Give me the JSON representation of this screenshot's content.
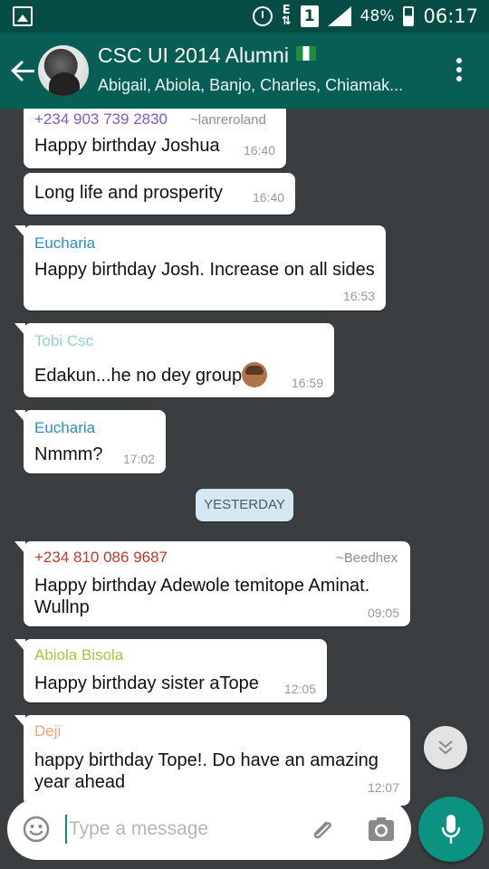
{
  "status_bar": {
    "battery": "48%",
    "time": "06:17",
    "data_indicator": "E",
    "sim_slot": "1"
  },
  "header": {
    "group_name": "CSC UI 2014 Alumni",
    "members": "Abigail, Abiola, Banjo, Charles, Chiamak..."
  },
  "messages": [
    {
      "sender": "+234 903 739 2830",
      "tag": "~lanreroland",
      "text": "Happy birthday Joshua",
      "time": "16:40",
      "sender_color": "#7c5bc4"
    },
    {
      "text": "Long life and prosperity",
      "time": "16:40"
    },
    {
      "sender": "Eucharia",
      "text": "Happy birthday Josh. Increase on all sides",
      "time": "16:53",
      "sender_color": "#2f8ad2"
    },
    {
      "sender": "Tobi Csc",
      "text": "Edakun...he no dey group",
      "time": "16:59",
      "sender_color": "#8fd6c9",
      "emoji": "man-facepalming-emoji"
    },
    {
      "sender": "Eucharia",
      "text": "Nmmm?",
      "time": "17:02",
      "sender_color": "#2f8ad2"
    },
    {
      "sender": "+234 810 086 9687",
      "tag": "~Beedhex",
      "text_line1": "Happy birthday Adewole temitope Aminat.",
      "text_line2": "Wullnp",
      "time": "09:05",
      "sender_color": "#c0392b"
    },
    {
      "sender": "Abiola Bisola",
      "text": "Happy birthday sister aTope",
      "time": "12:05",
      "sender_color": "#a9c23f"
    },
    {
      "sender": "Deji",
      "text_line1": "happy birthday Tope!. Do have an amazing",
      "text_line2": "year ahead",
      "time": "12:07",
      "sender_color": "#f5a27a"
    }
  ],
  "date_divider": "YESTERDAY",
  "composer": {
    "placeholder": "Type a message"
  },
  "colors": {
    "status_bar": "#054d44",
    "app_bar": "#075e54",
    "accent": "#0c9280",
    "chat_bg": "#3a3e41"
  }
}
